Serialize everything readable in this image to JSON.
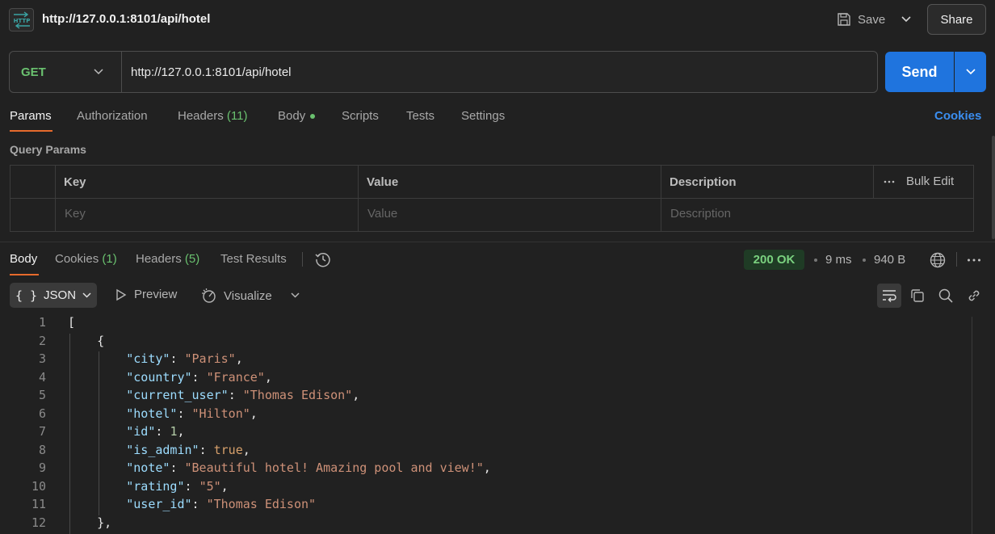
{
  "header": {
    "icon_text": "HTTP",
    "title": "http://127.0.0.1:8101/api/hotel",
    "save_label": "Save",
    "share_label": "Share"
  },
  "request": {
    "method": "GET",
    "url": "http://127.0.0.1:8101/api/hotel",
    "send_label": "Send"
  },
  "request_tabs": {
    "params": "Params",
    "authorization": "Authorization",
    "headers": "Headers",
    "headers_count": "(11)",
    "body": "Body",
    "scripts": "Scripts",
    "tests": "Tests",
    "settings": "Settings",
    "cookies": "Cookies"
  },
  "query_params": {
    "title": "Query Params",
    "columns": {
      "key": "Key",
      "value": "Value",
      "description": "Description"
    },
    "bulk_edit": "Bulk Edit",
    "placeholders": {
      "key": "Key",
      "value": "Value",
      "description": "Description"
    }
  },
  "response_tabs": {
    "body": "Body",
    "cookies": "Cookies",
    "cookies_count": "(1)",
    "headers": "Headers",
    "headers_count": "(5)",
    "test_results": "Test Results"
  },
  "response_meta": {
    "status": "200 OK",
    "time": "9 ms",
    "size": "940 B"
  },
  "response_toolbar": {
    "format": "JSON",
    "preview": "Preview",
    "visualize": "Visualize"
  },
  "code_lines": [
    {
      "n": "1",
      "t": "["
    },
    {
      "n": "2",
      "t": "    {"
    },
    {
      "n": "3",
      "t": "        \"city\": \"Paris\","
    },
    {
      "n": "4",
      "t": "        \"country\": \"France\","
    },
    {
      "n": "5",
      "t": "        \"current_user\": \"Thomas Edison\","
    },
    {
      "n": "6",
      "t": "        \"hotel\": \"Hilton\","
    },
    {
      "n": "7",
      "t": "        \"id\": 1,"
    },
    {
      "n": "8",
      "t": "        \"is_admin\": true,"
    },
    {
      "n": "9",
      "t": "        \"note\": \"Beautiful hotel! Amazing pool and view!\","
    },
    {
      "n": "10",
      "t": "        \"rating\": \"5\","
    },
    {
      "n": "11",
      "t": "        \"user_id\": \"Thomas Edison\""
    },
    {
      "n": "12",
      "t": "    },"
    }
  ],
  "colors": {
    "accent_blue": "#1f74de",
    "tab_underline": "#e66a2c",
    "method_green": "#6ac16f",
    "json_key": "#9cdcfe",
    "json_string": "#ce9178",
    "json_number": "#b5cea8"
  }
}
